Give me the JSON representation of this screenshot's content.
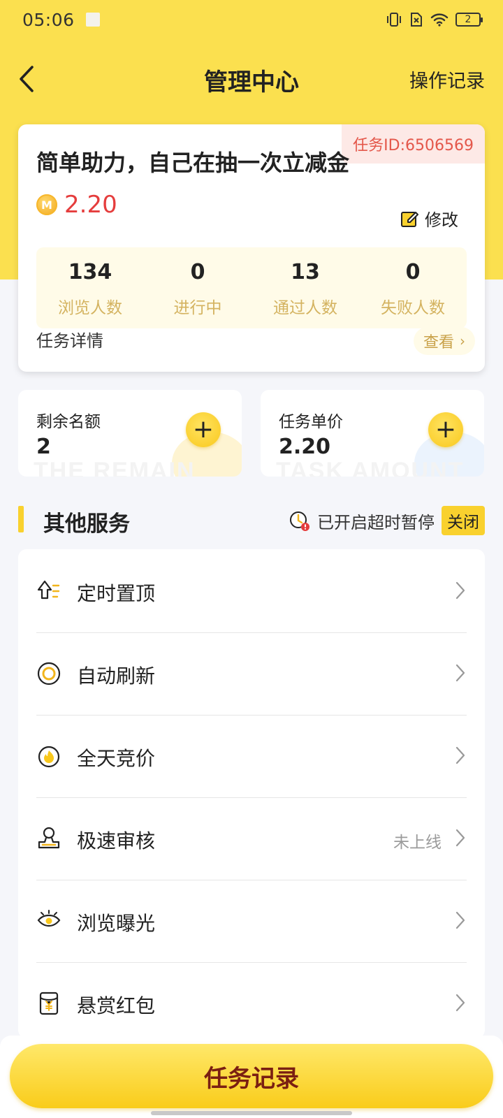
{
  "status_bar": {
    "time": "05:06",
    "battery": "2"
  },
  "nav": {
    "title": "管理中心",
    "right_action": "操作记录"
  },
  "task": {
    "id_badge": "任务ID:6506569",
    "title": "简单助力，自己在抽一次立减金",
    "coin_symbol": "M",
    "price": "2.20",
    "edit_label": "修改",
    "stats": [
      {
        "value": "134",
        "label": "浏览人数"
      },
      {
        "value": "0",
        "label": "进行中"
      },
      {
        "value": "13",
        "label": "通过人数"
      },
      {
        "value": "0",
        "label": "失败人数"
      }
    ],
    "detail_label": "任务详情",
    "view_label": "查看"
  },
  "quota": {
    "remaining_label": "剩余名额",
    "remaining_value": "2",
    "remaining_watermark": "THE REMAIN",
    "price_label": "任务单价",
    "price_value": "2.20",
    "price_watermark": "TASK AMOUNT",
    "plus": "+"
  },
  "services": {
    "title": "其他服务",
    "pause_text": "已开启超时暂停",
    "toggle_label": "关闭",
    "items": [
      {
        "label": "定时置顶",
        "hint": "",
        "icon": "pin-top-icon"
      },
      {
        "label": "自动刷新",
        "hint": "",
        "icon": "refresh-icon"
      },
      {
        "label": "全天竞价",
        "hint": "",
        "icon": "fire-icon"
      },
      {
        "label": "极速审核",
        "hint": "未上线",
        "icon": "review-stamp-icon"
      },
      {
        "label": "浏览曝光",
        "hint": "",
        "icon": "eye-icon"
      },
      {
        "label": "悬赏红包",
        "hint": "",
        "icon": "red-packet-icon"
      }
    ]
  },
  "bottom": {
    "button_label": "任务记录"
  },
  "colors": {
    "brand_yellow": "#fbe04f",
    "accent_red": "#e53d3d",
    "stat_label": "#d4b360"
  }
}
